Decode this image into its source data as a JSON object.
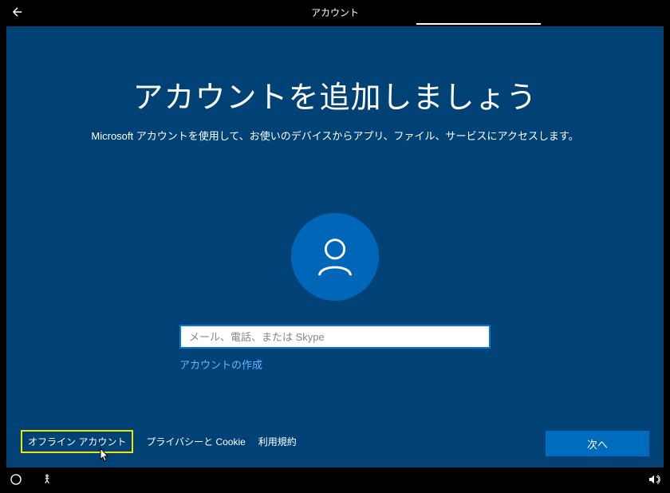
{
  "header": {
    "tab_label": "アカウント"
  },
  "main": {
    "heading": "アカウントを追加しましょう",
    "subtext": "Microsoft アカウントを使用して、お使いのデバイスからアプリ、ファイル、サービスにアクセスします。",
    "input_placeholder": "メール、電話、または Skype",
    "create_account_label": "アカウントの作成"
  },
  "footer": {
    "offline_account_label": "オフライン アカウント",
    "privacy_label": "プライバシーと Cookie",
    "terms_label": "利用規約",
    "next_button_label": "次へ"
  }
}
